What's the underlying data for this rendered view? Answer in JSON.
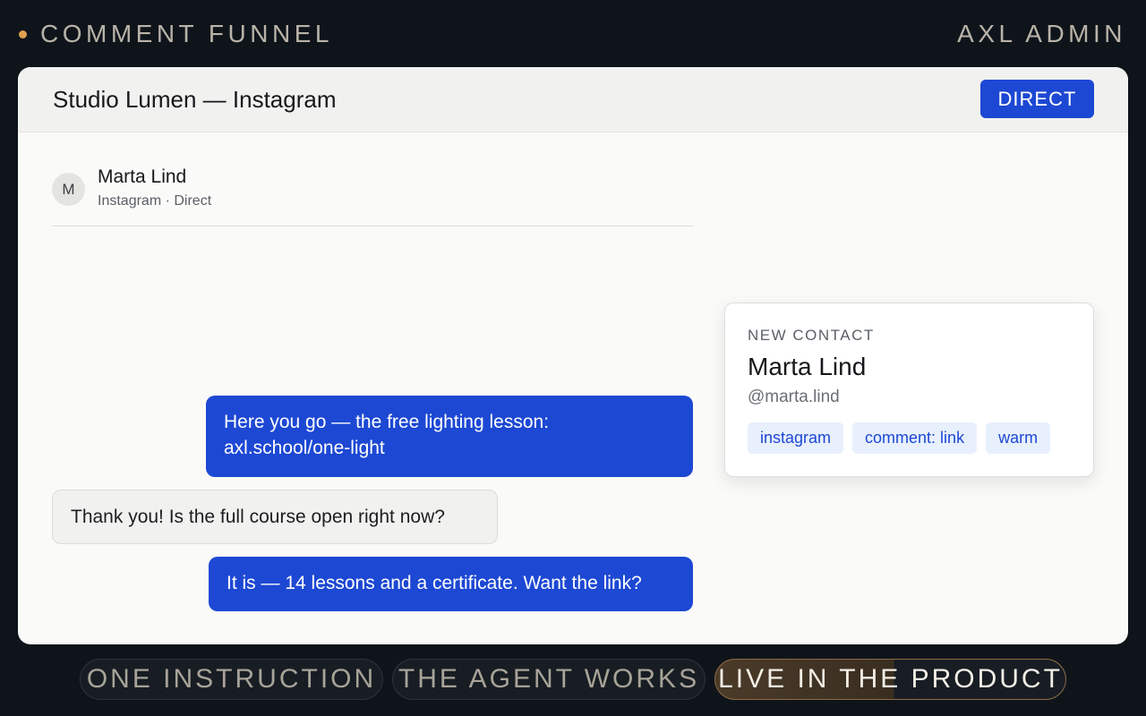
{
  "header": {
    "app_title": "COMMENT FUNNEL",
    "admin_label": "AXL ADMIN"
  },
  "panel": {
    "title": "Studio Lumen — Instagram",
    "direct_button": "DIRECT"
  },
  "contact": {
    "initial": "M",
    "name": "Marta Lind",
    "subtitle": "Instagram · Direct"
  },
  "messages": [
    {
      "from": "agent",
      "text": "Here you go — the free lighting lesson:",
      "text2": "axl.school/one-light"
    },
    {
      "from": "contact",
      "text": "Thank you! Is the full course open right now?"
    },
    {
      "from": "agent",
      "text": "It is — 14 lessons and a certificate. Want the link?"
    }
  ],
  "new_contact_card": {
    "label": "NEW CONTACT",
    "name": "Marta Lind",
    "handle": "@marta.lind",
    "tags": [
      "instagram",
      "comment: link",
      "warm"
    ]
  },
  "steps": [
    "ONE INSTRUCTION",
    "THE AGENT WORKS",
    "LIVE IN THE PRODUCT"
  ],
  "colors": {
    "accent_blue": "#1d48d3",
    "status_dot": "#e0a050",
    "tag_bg": "#e8f0fd",
    "tag_text": "#1d48d3",
    "background": "#0f141b"
  }
}
